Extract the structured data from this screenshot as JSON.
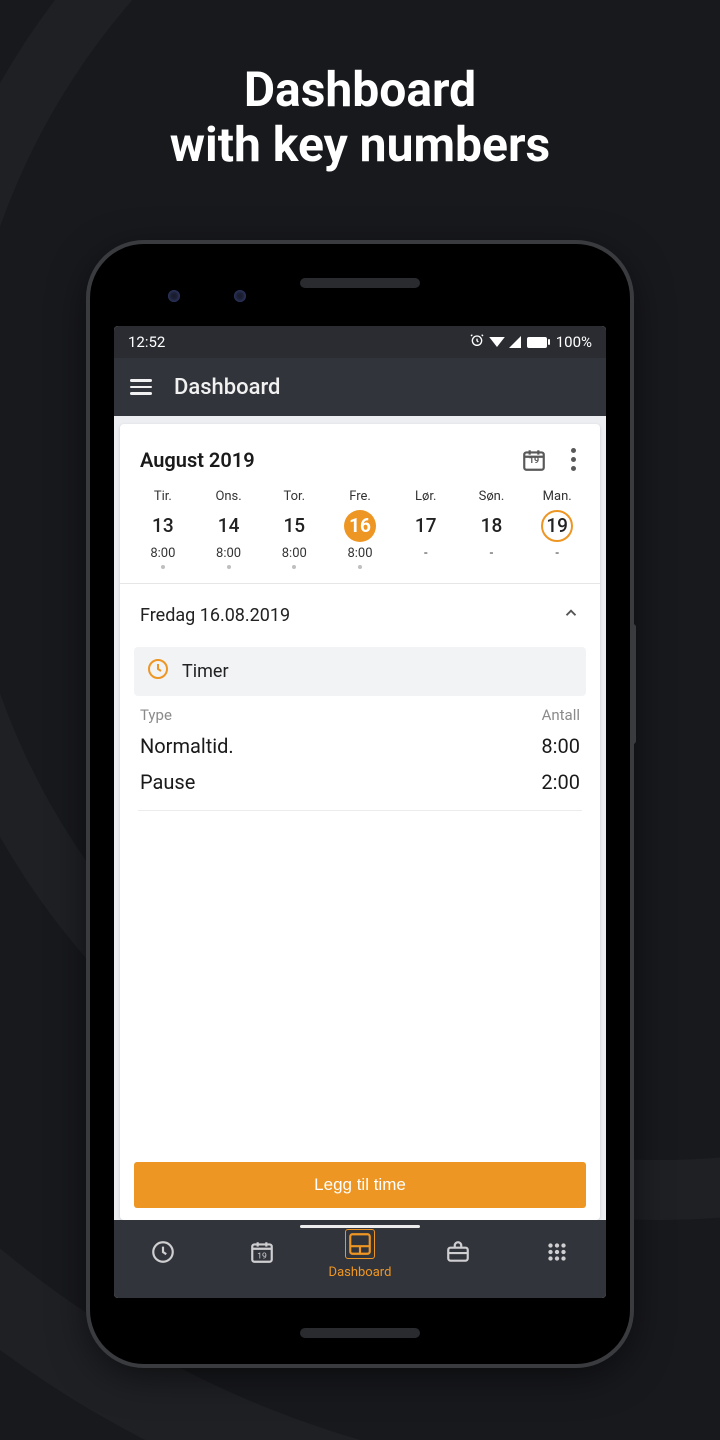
{
  "promo": {
    "line1": "Dashboard",
    "line2": "with key numbers"
  },
  "status": {
    "time": "12:52",
    "battery": "100%"
  },
  "appbar": {
    "title": "Dashboard"
  },
  "calendar": {
    "month_label": "August 2019",
    "today_badge": "19",
    "days": [
      {
        "dow": "Tir.",
        "num": "13",
        "hours": "8:00",
        "dot": true,
        "selected": false,
        "today": false
      },
      {
        "dow": "Ons.",
        "num": "14",
        "hours": "8:00",
        "dot": true,
        "selected": false,
        "today": false
      },
      {
        "dow": "Tor.",
        "num": "15",
        "hours": "8:00",
        "dot": true,
        "selected": false,
        "today": false
      },
      {
        "dow": "Fre.",
        "num": "16",
        "hours": "8:00",
        "dot": true,
        "selected": true,
        "today": false
      },
      {
        "dow": "Lør.",
        "num": "17",
        "hours": "-",
        "dot": false,
        "selected": false,
        "today": false
      },
      {
        "dow": "Søn.",
        "num": "18",
        "hours": "-",
        "dot": false,
        "selected": false,
        "today": false
      },
      {
        "dow": "Man.",
        "num": "19",
        "hours": "-",
        "dot": false,
        "selected": false,
        "today": true
      }
    ]
  },
  "selected_date_label": "Fredag 16.08.2019",
  "timer_section": {
    "heading": "Timer",
    "col_type": "Type",
    "col_count": "Antall",
    "rows": [
      {
        "type": "Normaltid.",
        "count": "8:00"
      },
      {
        "type": "Pause",
        "count": "2:00"
      }
    ]
  },
  "cta_label": "Legg til time",
  "bottomnav": {
    "items": [
      {
        "icon": "clock",
        "label": "",
        "active": false
      },
      {
        "icon": "calendar",
        "label": "",
        "active": false
      },
      {
        "icon": "dash",
        "label": "Dashboard",
        "active": true
      },
      {
        "icon": "brief",
        "label": "",
        "active": false
      },
      {
        "icon": "grid",
        "label": "",
        "active": false
      }
    ]
  },
  "colors": {
    "accent": "#ee9623"
  }
}
